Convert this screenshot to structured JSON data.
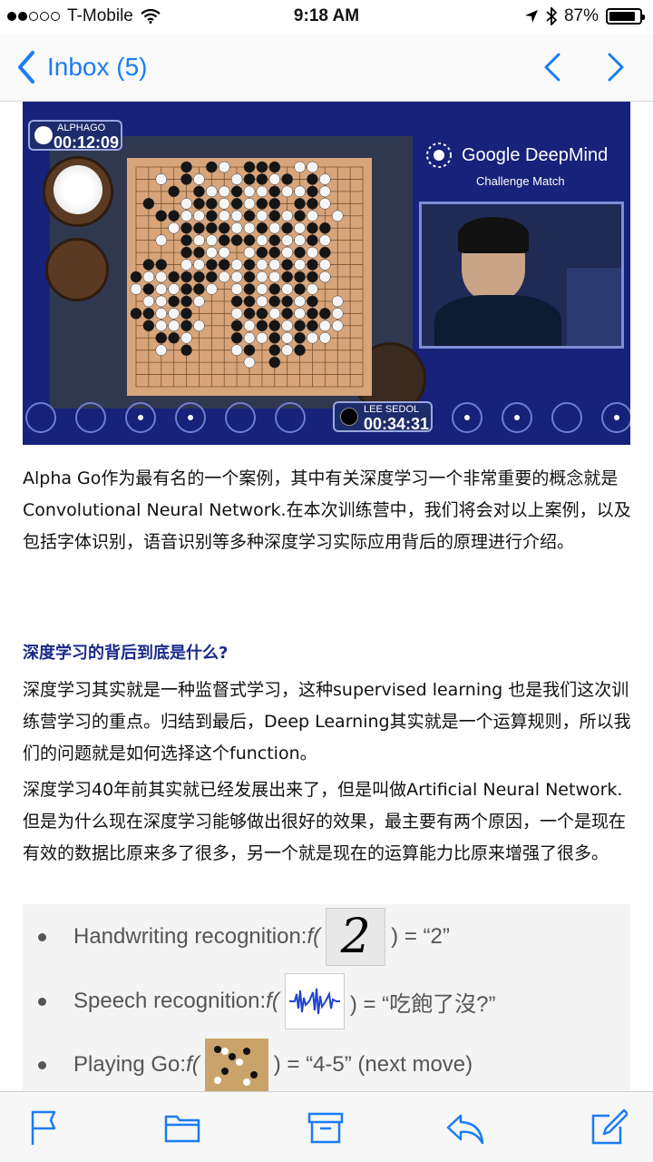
{
  "status_bar": {
    "carrier": "T-Mobile",
    "time": "9:18 AM",
    "battery_percent": "87%",
    "battery_level": 0.87,
    "signal_bars_filled": 2,
    "signal_bars_total": 5
  },
  "nav": {
    "back_label": "Inbox (5)",
    "accent_color": "#1a7cf5"
  },
  "hero": {
    "player1_name": "ALPHAGO",
    "player1_time": "00:12:09",
    "player2_name": "LEE SEDOL",
    "player2_time": "00:34:31",
    "brand_title": "Google DeepMind",
    "brand_subtitle": "Challenge Match"
  },
  "article": {
    "intro": "Alpha Go作为最有名的一个案例，其中有关深度学习一个非常重要的概念就是Convolutional Neural Network.在本次训练营中，我们将会对以上案例，以及包括字体识别，语音识别等多种深度学习实际应用背后的原理进行介绍。",
    "heading": "深度学习的背后到底是什么?",
    "para1": "深度学习其实就是一种监督式学习，这种supervised learning 也是我们这次训练营学习的重点。归结到最后，Deep Learning其实就是一个运算规则，所以我们的问题就是如何选择这个function。",
    "para2": "深度学习40年前其实就已经发展出来了，但是叫做Artificial Neural Network.但是为什么现在深度学习能够做出很好的效果，最主要有两个原因，一个是现在有效的数据比原来多了很多，另一个就是现在的运算能力比原来增强了很多。"
  },
  "slide": {
    "row1_label": "Handwriting recognition: ",
    "row1_result": ") = “2”",
    "row2_label": "Speech recognition: ",
    "row2_result": ") = “吃飽了沒?”",
    "row3_label": "Playing Go: ",
    "row3_result": ") = “4-5” (next move)",
    "func": "f(",
    "digit": "2"
  },
  "toolbar": {
    "icons": [
      "flag-icon",
      "folder-icon",
      "archive-icon",
      "reply-icon",
      "compose-icon"
    ]
  }
}
